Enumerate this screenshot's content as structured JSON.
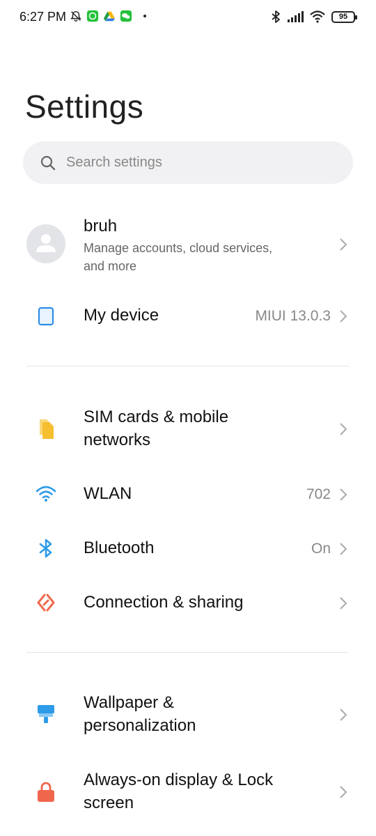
{
  "status_bar": {
    "time": "6:27 PM",
    "battery": "95",
    "icons_left": [
      "mute-icon",
      "whatsapp-icon",
      "drive-icon",
      "wechat-icon"
    ],
    "icons_right": [
      "bluetooth-icon",
      "signal-icon",
      "wifi-icon",
      "battery-icon"
    ]
  },
  "page": {
    "title": "Settings"
  },
  "search": {
    "placeholder": "Search settings"
  },
  "account": {
    "name": "bruh",
    "subtitle_line1": "Manage accounts, cloud services,",
    "subtitle_line2": "and more"
  },
  "items": {
    "my_device": {
      "label": "My device",
      "value": "MIUI 13.0.3",
      "icon": "phone-icon",
      "color": "#2e8ee8"
    },
    "sim": {
      "label_line1": "SIM cards & mobile",
      "label_line2": "networks",
      "icon": "sim-icon",
      "color": "#f6bf30"
    },
    "wlan": {
      "label": "WLAN",
      "value": "702",
      "icon": "wifi-icon",
      "color": "#2e9be8"
    },
    "bluetooth": {
      "label": "Bluetooth",
      "value": "On",
      "icon": "bluetooth-icon",
      "color": "#2e9be8"
    },
    "connection": {
      "label": "Connection & sharing",
      "icon": "connection-icon",
      "color": "#ef6a4c"
    },
    "wallpaper": {
      "label_line1": "Wallpaper &",
      "label_line2": "personalization",
      "icon": "paint-roller-icon",
      "color": "#2e9be8"
    },
    "lock": {
      "label_line1": "Always-on display & Lock",
      "label_line2": "screen",
      "icon": "lock-icon",
      "color": "#f0664d"
    }
  }
}
